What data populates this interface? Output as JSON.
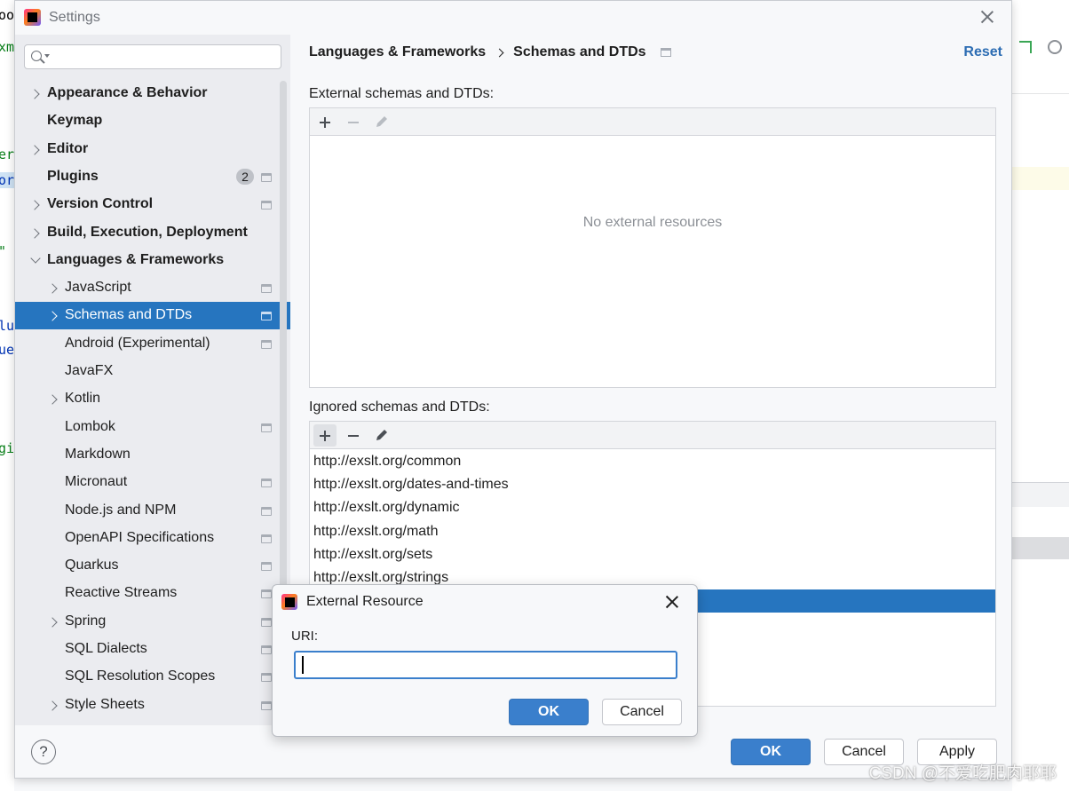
{
  "window": {
    "title": "Settings"
  },
  "search": {
    "placeholder": ""
  },
  "sidebar": {
    "items": [
      {
        "label": "Appearance & Behavior",
        "bold": true,
        "chevron": "right",
        "level": 0
      },
      {
        "label": "Keymap",
        "bold": true,
        "chevron": null,
        "level": 0
      },
      {
        "label": "Editor",
        "bold": true,
        "chevron": "right",
        "level": 0
      },
      {
        "label": "Plugins",
        "bold": true,
        "chevron": null,
        "level": 0,
        "badge": "2",
        "project_icon": true
      },
      {
        "label": "Version Control",
        "bold": true,
        "chevron": "right",
        "level": 0,
        "project_icon": true
      },
      {
        "label": "Build, Execution, Deployment",
        "bold": true,
        "chevron": "right",
        "level": 0
      },
      {
        "label": "Languages & Frameworks",
        "bold": true,
        "chevron": "down",
        "level": 0
      },
      {
        "label": "JavaScript",
        "chevron": "right",
        "level": 1,
        "project_icon": true
      },
      {
        "label": "Schemas and DTDs",
        "chevron": "right",
        "level": 1,
        "project_icon": true,
        "selected": true
      },
      {
        "label": "Android (Experimental)",
        "chevron": null,
        "level": 1,
        "project_icon": true
      },
      {
        "label": "JavaFX",
        "chevron": null,
        "level": 1
      },
      {
        "label": "Kotlin",
        "chevron": "right",
        "level": 1
      },
      {
        "label": "Lombok",
        "chevron": null,
        "level": 1,
        "project_icon": true
      },
      {
        "label": "Markdown",
        "chevron": null,
        "level": 1
      },
      {
        "label": "Micronaut",
        "chevron": null,
        "level": 1,
        "project_icon": true
      },
      {
        "label": "Node.js and NPM",
        "chevron": null,
        "level": 1,
        "project_icon": true
      },
      {
        "label": "OpenAPI Specifications",
        "chevron": null,
        "level": 1,
        "project_icon": true
      },
      {
        "label": "Quarkus",
        "chevron": null,
        "level": 1,
        "project_icon": true
      },
      {
        "label": "Reactive Streams",
        "chevron": null,
        "level": 1,
        "project_icon": true
      },
      {
        "label": "Spring",
        "chevron": "right",
        "level": 1,
        "project_icon": true
      },
      {
        "label": "SQL Dialects",
        "chevron": null,
        "level": 1,
        "project_icon": true
      },
      {
        "label": "SQL Resolution Scopes",
        "chevron": null,
        "level": 1,
        "project_icon": true
      },
      {
        "label": "Style Sheets",
        "chevron": "right",
        "level": 1,
        "project_icon": true
      }
    ]
  },
  "breadcrumb": {
    "parent": "Languages & Frameworks",
    "current": "Schemas and DTDs"
  },
  "reset_label": "Reset",
  "external": {
    "label": "External schemas and DTDs:",
    "empty_text": "No external resources"
  },
  "ignored": {
    "label": "Ignored schemas and DTDs:",
    "rows": [
      "http://exslt.org/common",
      "http://exslt.org/dates-and-times",
      "http://exslt.org/dynamic",
      "http://exslt.org/math",
      "http://exslt.org/sets",
      "http://exslt.org/strings",
      ""
    ],
    "selected_row": 6
  },
  "footer": {
    "help": "?",
    "ok": "OK",
    "cancel": "Cancel",
    "apply": "Apply"
  },
  "modal": {
    "title": "External Resource",
    "uri_label": "URI:",
    "uri_value": "",
    "ok": "OK",
    "cancel": "Cancel"
  },
  "colors": {
    "selection": "#2675bf",
    "primary_button": "#3a7fcc",
    "link": "#2d6db3"
  },
  "watermark": "CSDN @不爱吃肥肉耶耶"
}
